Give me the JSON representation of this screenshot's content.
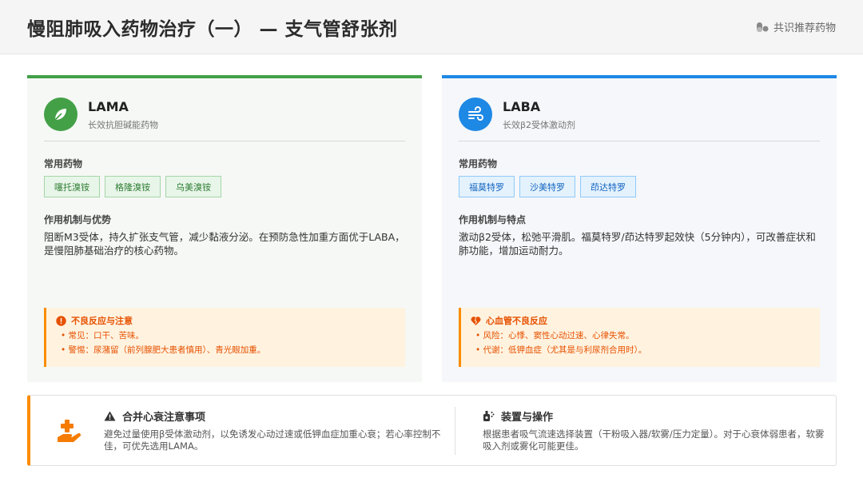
{
  "header": {
    "title": "慢阻肺吸入药物治疗（一） — 支气管舒张剂",
    "tag": "共识推荐药物"
  },
  "lama": {
    "title": "LAMA",
    "subtitle": "长效抗胆碱能药物",
    "drugs_label": "常用药物",
    "drugs": [
      "噻托溴铵",
      "格隆溴铵",
      "乌美溴铵"
    ],
    "mechanism_label": "作用机制与优势",
    "mechanism": "阻断M3受体，持久扩张支气管，减少黏液分泌。在预防急性加重方面优于LABA，是慢阻肺基础治疗的核心药物。",
    "warning_title": "不良反应与注意",
    "warning_lines": [
      "• 常见：口干、苦味。",
      "• 警惕：尿潴留（前列腺肥大患者慎用）、青光眼加重。"
    ]
  },
  "laba": {
    "title": "LABA",
    "subtitle": "长效β2受体激动剂",
    "drugs_label": "常用药物",
    "drugs": [
      "福莫特罗",
      "沙美特罗",
      "茚达特罗"
    ],
    "mechanism_label": "作用机制与特点",
    "mechanism": "激动β2受体，松弛平滑肌。福莫特罗/茚达特罗起效快（5分钟内），可改善症状和肺功能，增加运动耐力。",
    "warning_title": "心血管不良反应",
    "warning_lines": [
      "• 风险：心悸、窦性心动过速、心律失常。",
      "• 代谢：低钾血症（尤其是与利尿剂合用时）。"
    ]
  },
  "bottom": {
    "heart_title": "合并心衰注意事项",
    "heart_text": "避免过量使用β受体激动剂，以免诱发心动过速或低钾血症加重心衰；若心率控制不佳，可优先选用LAMA。",
    "device_title": "装置与操作",
    "device_text": "根据患者吸气流速选择装置（干粉吸入器/软雾/压力定量）。对于心衰体弱患者，软雾吸入剂或雾化可能更佳。"
  },
  "colors": {
    "lama_accent": "#43a047",
    "laba_accent": "#1e88e5",
    "warning": "#fb8c00"
  },
  "icons": {
    "header_tag": "pills-icon",
    "lama": "leaf-icon",
    "laba": "wind-icon",
    "lama_warning": "exclamation-circle-icon",
    "laba_warning": "heart-crack-icon",
    "bottom_left": "hand-holding-medical-icon",
    "heart_title": "warning-triangle-icon",
    "device_title": "inhaler-icon"
  }
}
